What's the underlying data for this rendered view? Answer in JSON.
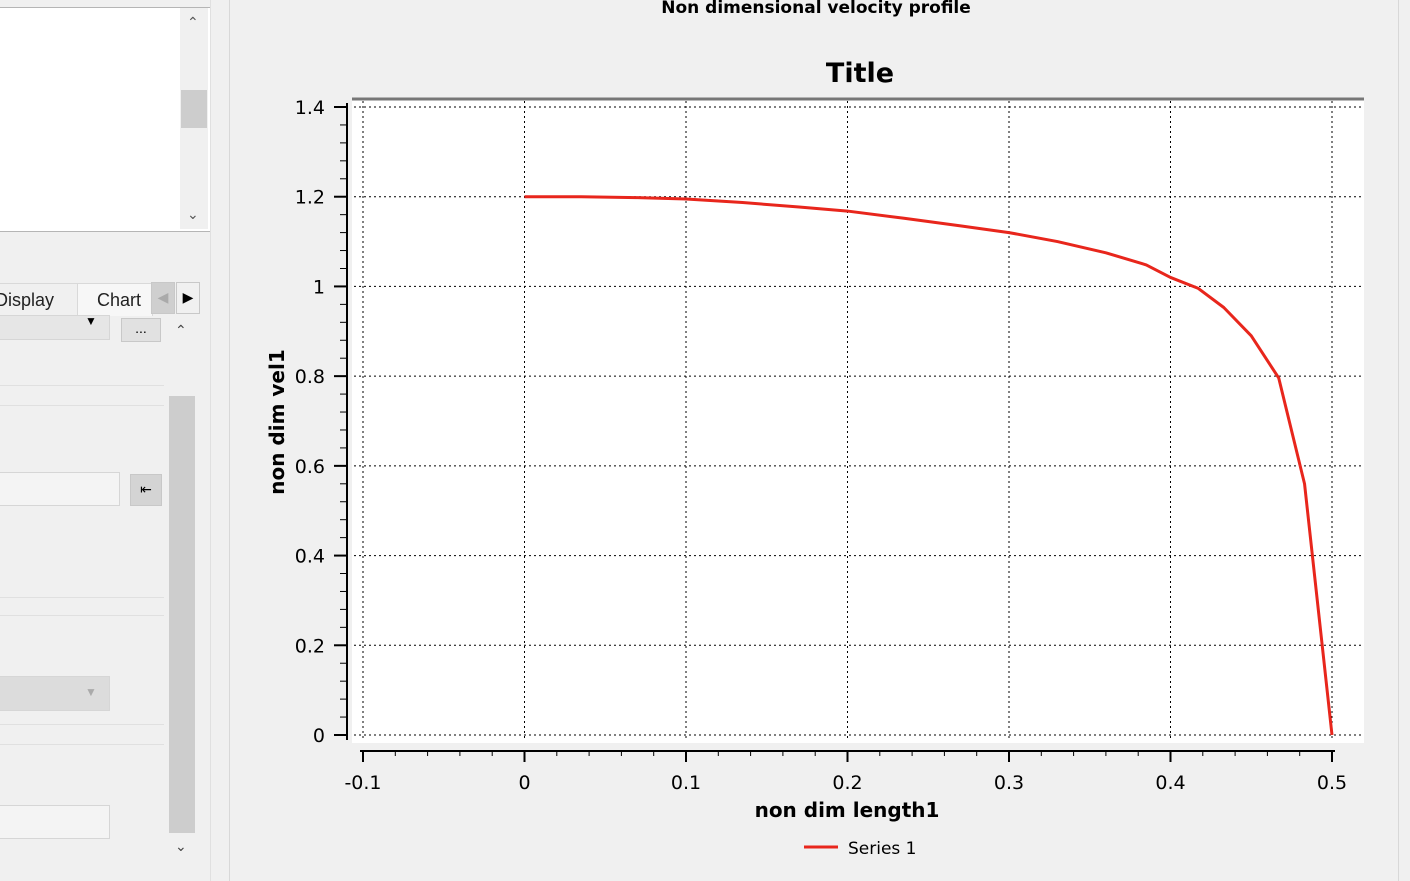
{
  "window": {
    "heading": "Non dimensional velocity profile"
  },
  "left_panel": {
    "tabs": [
      {
        "label": "Display"
      },
      {
        "label": "Chart"
      }
    ],
    "more_button": "...",
    "icons": [
      "chevron-up-icon",
      "chevron-down-icon",
      "tab-scroll-left-icon",
      "tab-scroll-right-icon",
      "dropdown-arrow-icon",
      "pick-from-list-icon"
    ]
  },
  "chart_data": {
    "type": "line",
    "title": "Title",
    "xlabel": "non dim length1",
    "ylabel": "non dim vel1",
    "xlim": [
      -0.1,
      0.5
    ],
    "ylim": [
      0,
      1.4
    ],
    "xticks": [
      "-0.1",
      "0",
      "0.1",
      "0.2",
      "0.3",
      "0.4",
      "0.5"
    ],
    "yticks": [
      "0",
      "0.2",
      "0.4",
      "0.6",
      "0.8",
      "1",
      "1.2",
      "1.4"
    ],
    "grid": true,
    "legend": "bottom",
    "series": [
      {
        "name": "Series 1",
        "color": "#e8261c",
        "x": [
          0,
          0.035,
          0.07,
          0.1,
          0.135,
          0.17,
          0.2,
          0.235,
          0.27,
          0.3,
          0.33,
          0.36,
          0.385,
          0.4,
          0.417,
          0.433,
          0.45,
          0.467,
          0.483,
          0.5
        ],
        "y": [
          1.2,
          1.2,
          1.198,
          1.195,
          1.187,
          1.177,
          1.168,
          1.152,
          1.135,
          1.12,
          1.1,
          1.075,
          1.048,
          1.02,
          0.996,
          0.953,
          0.89,
          0.796,
          0.56,
          0.0
        ]
      }
    ]
  }
}
